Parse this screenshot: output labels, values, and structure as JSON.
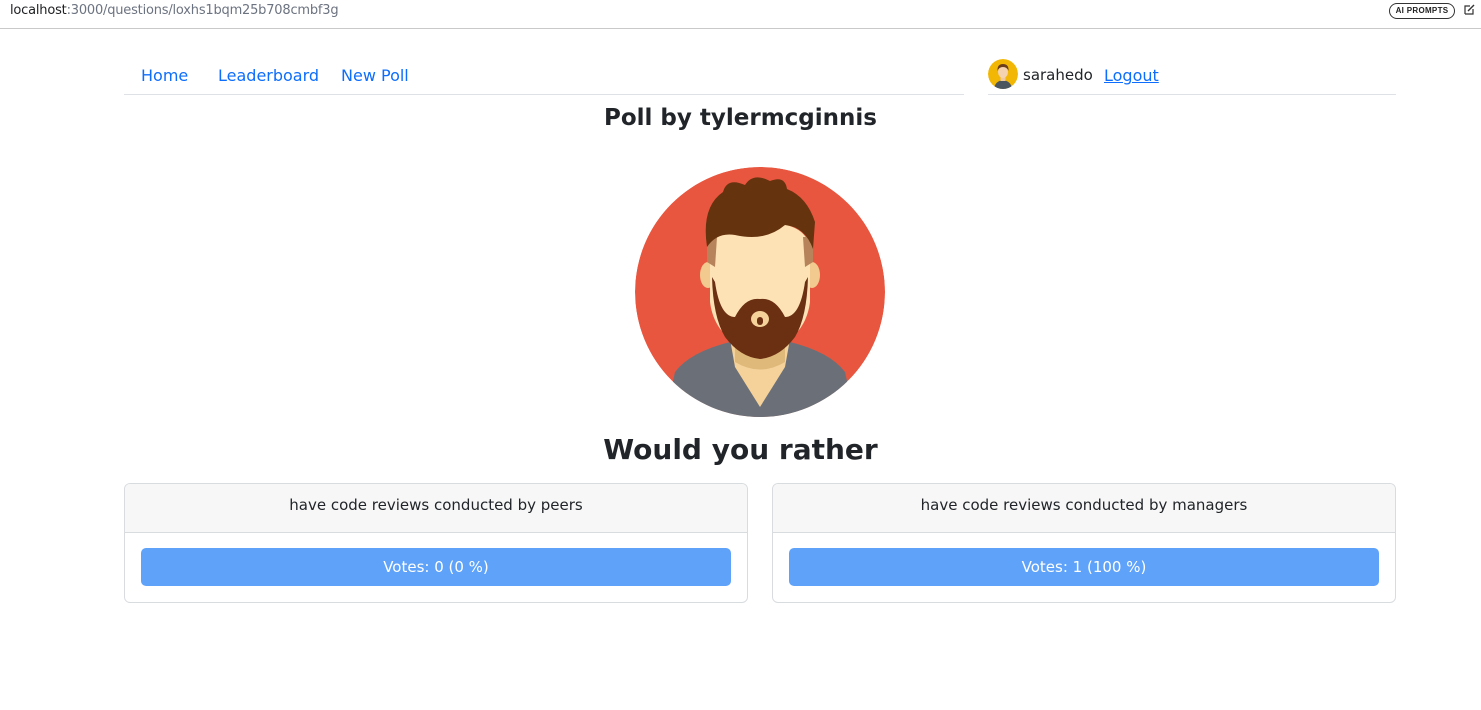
{
  "browser": {
    "url_host": "localhost",
    "url_path": ":3000/questions/loxhs1bqm25b708cmbf3g",
    "ai_badge": "AI PROMPTS"
  },
  "nav": {
    "links": [
      "Home",
      "Leaderboard",
      "New Poll"
    ],
    "username": "sarahedo",
    "logout": "Logout"
  },
  "poll": {
    "title": "Poll by tylermcginnis",
    "question": "Would you rather",
    "options": [
      {
        "text": "have code reviews conducted by peers",
        "votes_label": "Votes: 0 (0 %)",
        "votes": 0,
        "percent": 0
      },
      {
        "text": "have code reviews conducted by managers",
        "votes_label": "Votes: 1 (100 %)",
        "votes": 1,
        "percent": 100
      }
    ]
  },
  "colors": {
    "link": "#0d6efd",
    "vote_bar": "#5ea2fa",
    "avatar_bg": "#e8563f",
    "user_avatar_bg": "#f2b705"
  },
  "icons": {
    "edit": "edit-icon",
    "user_avatar": "user-avatar",
    "author_avatar": "author-avatar"
  }
}
